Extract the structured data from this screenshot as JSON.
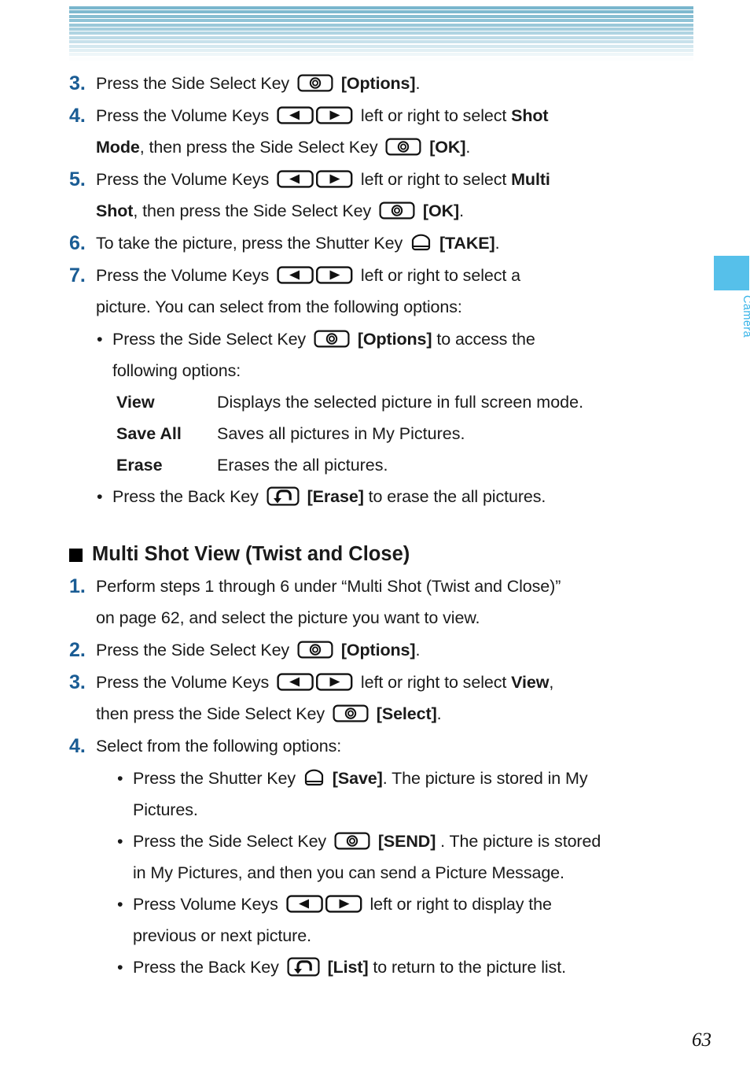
{
  "page": {
    "number": "63",
    "side_tab_label": "Camera",
    "accent_blue": "#1a5c94",
    "tab_blue": "#56c0ea",
    "tab_text_blue": "#36b3e8",
    "header_stripe_top_color": "#79b6cd",
    "header_stripe_bottom_color": "#fbfdfe"
  },
  "steps_top": [
    {
      "num": "3.",
      "lines": [
        [
          {
            "t": "text",
            "v": "Press the Side Select Key "
          },
          {
            "t": "icon",
            "v": "side-select-key-icon"
          },
          {
            "t": "text",
            "v": " "
          },
          {
            "t": "bold",
            "v": "[Options]"
          },
          {
            "t": "text",
            "v": "."
          }
        ]
      ]
    },
    {
      "num": "4.",
      "lines": [
        [
          {
            "t": "text",
            "v": "Press the Volume Keys "
          },
          {
            "t": "icon",
            "v": "volume-keys-icon"
          },
          {
            "t": "text",
            "v": " left or right to select "
          },
          {
            "t": "bold",
            "v": "Shot"
          }
        ],
        [
          {
            "t": "bold",
            "v": "Mode"
          },
          {
            "t": "text",
            "v": ", then press the Side Select Key "
          },
          {
            "t": "icon",
            "v": "side-select-key-icon"
          },
          {
            "t": "text",
            "v": " "
          },
          {
            "t": "bold",
            "v": "[OK]"
          },
          {
            "t": "text",
            "v": "."
          }
        ]
      ]
    },
    {
      "num": "5.",
      "lines": [
        [
          {
            "t": "text",
            "v": "Press the Volume Keys "
          },
          {
            "t": "icon",
            "v": "volume-keys-icon"
          },
          {
            "t": "text",
            "v": " left or right to select "
          },
          {
            "t": "bold",
            "v": "Multi"
          }
        ],
        [
          {
            "t": "bold",
            "v": "Shot"
          },
          {
            "t": "text",
            "v": ", then press the Side Select Key "
          },
          {
            "t": "icon",
            "v": "side-select-key-icon"
          },
          {
            "t": "text",
            "v": " "
          },
          {
            "t": "bold",
            "v": "[OK]"
          },
          {
            "t": "text",
            "v": "."
          }
        ]
      ]
    },
    {
      "num": "6.",
      "lines": [
        [
          {
            "t": "text",
            "v": "To take the picture, press the Shutter Key "
          },
          {
            "t": "icon",
            "v": "shutter-key-icon"
          },
          {
            "t": "text",
            "v": " "
          },
          {
            "t": "bold",
            "v": "[TAKE]"
          },
          {
            "t": "text",
            "v": "."
          }
        ]
      ]
    },
    {
      "num": "7.",
      "lines": [
        [
          {
            "t": "text",
            "v": "Press the Volume Keys "
          },
          {
            "t": "icon",
            "v": "volume-keys-icon"
          },
          {
            "t": "text",
            "v": " left or right to select a"
          }
        ],
        [
          {
            "t": "text",
            "v": "picture. You can select from the following options:"
          }
        ]
      ]
    }
  ],
  "step7_bullets": [
    {
      "lines": [
        [
          {
            "t": "text",
            "v": "Press the Side Select Key "
          },
          {
            "t": "icon",
            "v": "side-select-key-icon"
          },
          {
            "t": "text",
            "v": " "
          },
          {
            "t": "bold",
            "v": "[Options]"
          },
          {
            "t": "text",
            "v": " to access the"
          }
        ],
        [
          {
            "t": "text",
            "v": "following options:"
          }
        ]
      ]
    }
  ],
  "options_table": [
    {
      "term": "View",
      "def": "Displays the selected picture in full screen mode."
    },
    {
      "term": "Save All",
      "def": "Saves all pictures in My Pictures."
    },
    {
      "term": "Erase",
      "def": "Erases the all pictures."
    }
  ],
  "step7_bullet_last": {
    "lines": [
      [
        {
          "t": "text",
          "v": "Press the Back Key "
        },
        {
          "t": "icon",
          "v": "back-key-icon"
        },
        {
          "t": "text",
          "v": " "
        },
        {
          "t": "bold",
          "v": "[Erase]"
        },
        {
          "t": "text",
          "v": " to erase the all pictures."
        }
      ]
    ]
  },
  "section": {
    "heading": "Multi Shot View (Twist and Close)",
    "bullet_glyph": "square"
  },
  "steps_bottom": [
    {
      "num": "1.",
      "lines": [
        [
          {
            "t": "text",
            "v": "Perform steps 1 through 6 under “Multi Shot (Twist and Close)”"
          }
        ],
        [
          {
            "t": "text",
            "v": "on page 62, and select the picture you want to view."
          }
        ]
      ]
    },
    {
      "num": "2.",
      "lines": [
        [
          {
            "t": "text",
            "v": "Press the Side Select Key "
          },
          {
            "t": "icon",
            "v": "side-select-key-icon"
          },
          {
            "t": "text",
            "v": " "
          },
          {
            "t": "bold",
            "v": "[Options]"
          },
          {
            "t": "text",
            "v": "."
          }
        ]
      ]
    },
    {
      "num": "3.",
      "lines": [
        [
          {
            "t": "text",
            "v": "Press the Volume Keys "
          },
          {
            "t": "icon",
            "v": "volume-keys-icon"
          },
          {
            "t": "text",
            "v": " left or right to select "
          },
          {
            "t": "bold",
            "v": "View"
          },
          {
            "t": "text",
            "v": ","
          }
        ],
        [
          {
            "t": "text",
            "v": "then press the Side Select Key "
          },
          {
            "t": "icon",
            "v": "side-select-key-icon"
          },
          {
            "t": "text",
            "v": " "
          },
          {
            "t": "bold",
            "v": "[Select]"
          },
          {
            "t": "text",
            "v": "."
          }
        ]
      ]
    },
    {
      "num": "4.",
      "lines": [
        [
          {
            "t": "text",
            "v": "Select from the following options:"
          }
        ]
      ]
    }
  ],
  "step4_bullets": [
    {
      "lines": [
        [
          {
            "t": "text",
            "v": "Press the Shutter Key "
          },
          {
            "t": "icon",
            "v": "shutter-key-icon"
          },
          {
            "t": "text",
            "v": " "
          },
          {
            "t": "bold",
            "v": "[Save]"
          },
          {
            "t": "text",
            "v": ". The picture is stored in My"
          }
        ],
        [
          {
            "t": "text",
            "v": "Pictures."
          }
        ]
      ]
    },
    {
      "lines": [
        [
          {
            "t": "text",
            "v": "Press the Side Select Key "
          },
          {
            "t": "icon",
            "v": "side-select-key-icon"
          },
          {
            "t": "text",
            "v": " "
          },
          {
            "t": "bold",
            "v": "[SEND]"
          },
          {
            "t": "text",
            "v": " . The picture is stored"
          }
        ],
        [
          {
            "t": "text",
            "v": "in My Pictures, and then you can send a Picture Message."
          }
        ]
      ]
    },
    {
      "lines": [
        [
          {
            "t": "text",
            "v": "Press Volume Keys "
          },
          {
            "t": "icon",
            "v": "volume-keys-icon"
          },
          {
            "t": "text",
            "v": " left or right to display the"
          }
        ],
        [
          {
            "t": "text",
            "v": "previous or next picture."
          }
        ]
      ]
    },
    {
      "lines": [
        [
          {
            "t": "text",
            "v": "Press the Back Key "
          },
          {
            "t": "icon",
            "v": "back-key-icon"
          },
          {
            "t": "text",
            "v": " "
          },
          {
            "t": "bold",
            "v": "[List]"
          },
          {
            "t": "text",
            "v": " to return to the picture list."
          }
        ]
      ]
    }
  ]
}
